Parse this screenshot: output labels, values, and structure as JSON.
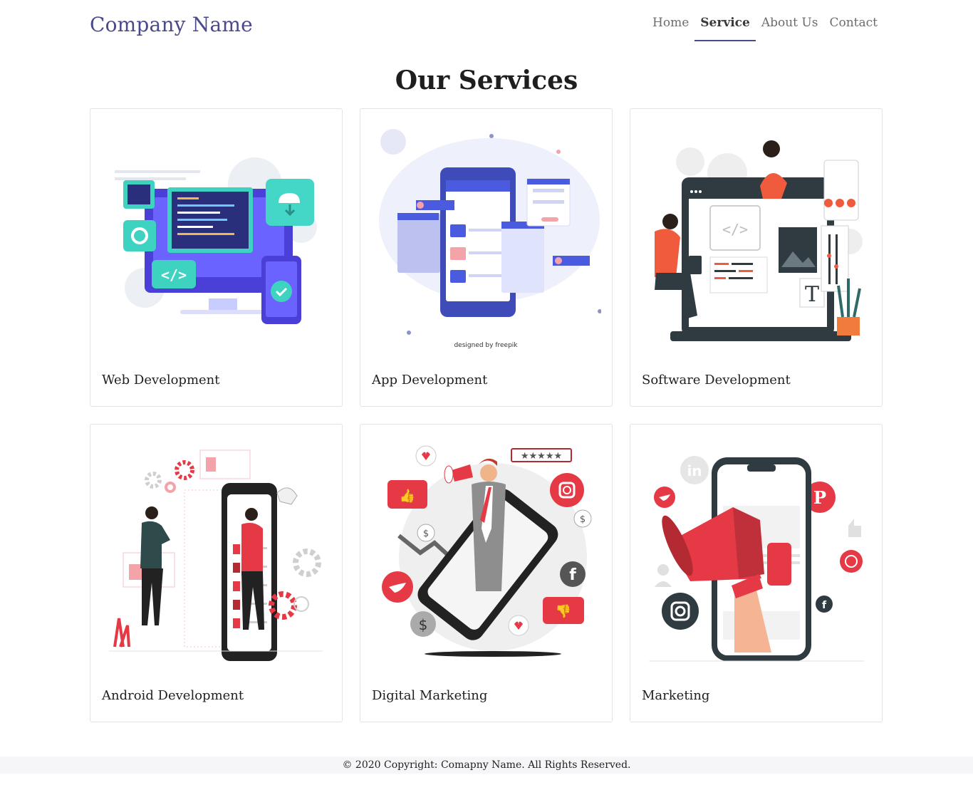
{
  "header": {
    "brand": "Company Name",
    "nav": [
      {
        "label": "Home",
        "active": false
      },
      {
        "label": "Service",
        "active": true
      },
      {
        "label": "About Us",
        "active": false
      },
      {
        "label": "Contact",
        "active": false
      }
    ]
  },
  "main": {
    "title": "Our Services",
    "cards": [
      {
        "title": "Web Development",
        "icon": "web-development-illustration"
      },
      {
        "title": "App Development",
        "icon": "app-development-illustration",
        "credit": "designed by freepik"
      },
      {
        "title": "Software Development",
        "icon": "software-development-illustration"
      },
      {
        "title": "Android Development",
        "icon": "android-development-illustration"
      },
      {
        "title": "Digital Marketing",
        "icon": "digital-marketing-illustration"
      },
      {
        "title": "Marketing",
        "icon": "marketing-illustration"
      }
    ]
  },
  "footer": {
    "text": "© 2020 Copyright: Comapny Name. All Rights Reserved."
  },
  "colors": {
    "brand": "#4a4a8a",
    "accent_red": "#e53945",
    "accent_blue": "#4b5be0",
    "accent_teal": "#3ed3c0",
    "dark": "#2f3b40"
  }
}
